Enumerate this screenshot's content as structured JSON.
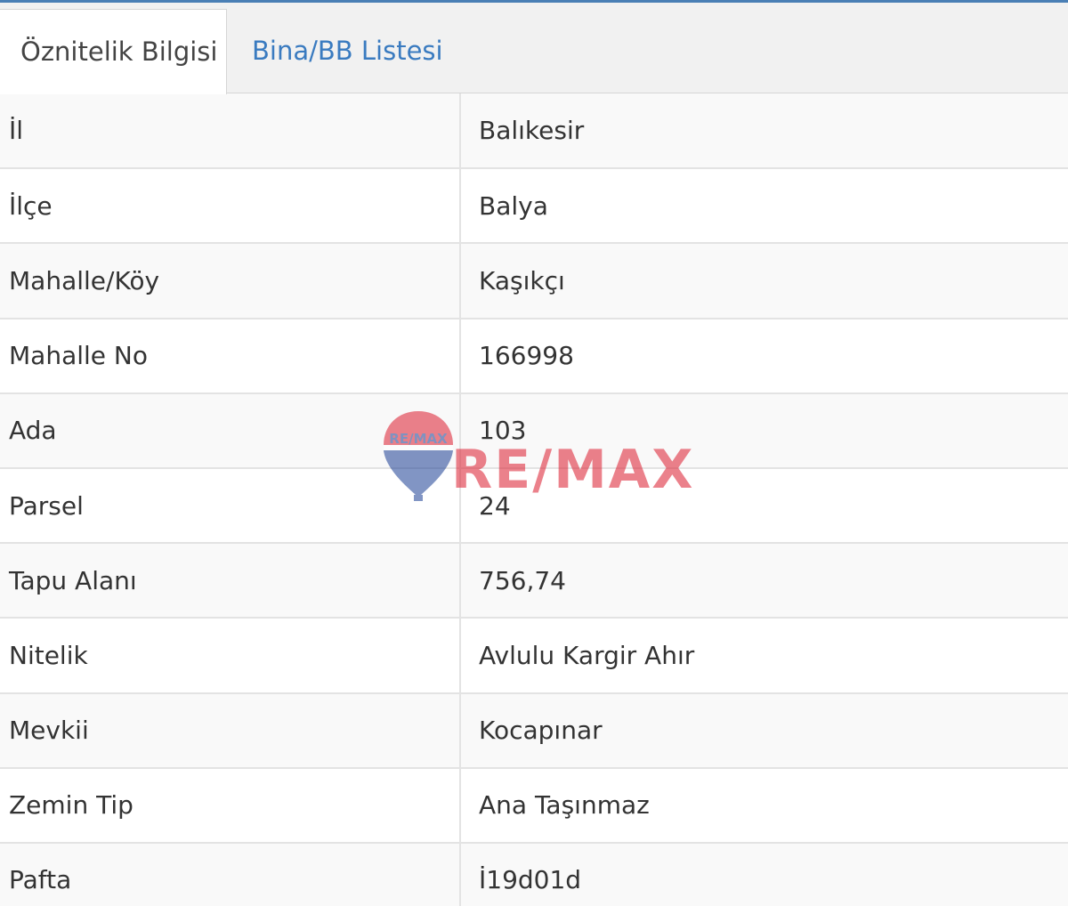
{
  "tabs": [
    {
      "label": "Öznitelik Bilgisi",
      "active": true
    },
    {
      "label": "Bina/BB Listesi",
      "active": false
    }
  ],
  "rows": [
    {
      "key": "İl",
      "value": "Balıkesir"
    },
    {
      "key": "İlçe",
      "value": "Balya"
    },
    {
      "key": "Mahalle/Köy",
      "value": "Kaşıkçı"
    },
    {
      "key": "Mahalle No",
      "value": "166998"
    },
    {
      "key": "Ada",
      "value": "103"
    },
    {
      "key": "Parsel",
      "value": "24"
    },
    {
      "key": "Tapu Alanı",
      "value": "756,74"
    },
    {
      "key": "Nitelik",
      "value": "Avlulu Kargir Ahır"
    },
    {
      "key": "Mevkii",
      "value": "Kocapınar"
    },
    {
      "key": "Zemin Tip",
      "value": "Ana Taşınmaz"
    },
    {
      "key": "Pafta",
      "value": "İ19d01d"
    }
  ],
  "watermark": {
    "logo_text": "RE/MAX",
    "balloon_text": "RE/MAX",
    "brand_red": "#dc1c2e",
    "brand_blue": "#1c3f94"
  },
  "colors": {
    "accent": "#4a7fb5",
    "link": "#3a7bc0"
  }
}
